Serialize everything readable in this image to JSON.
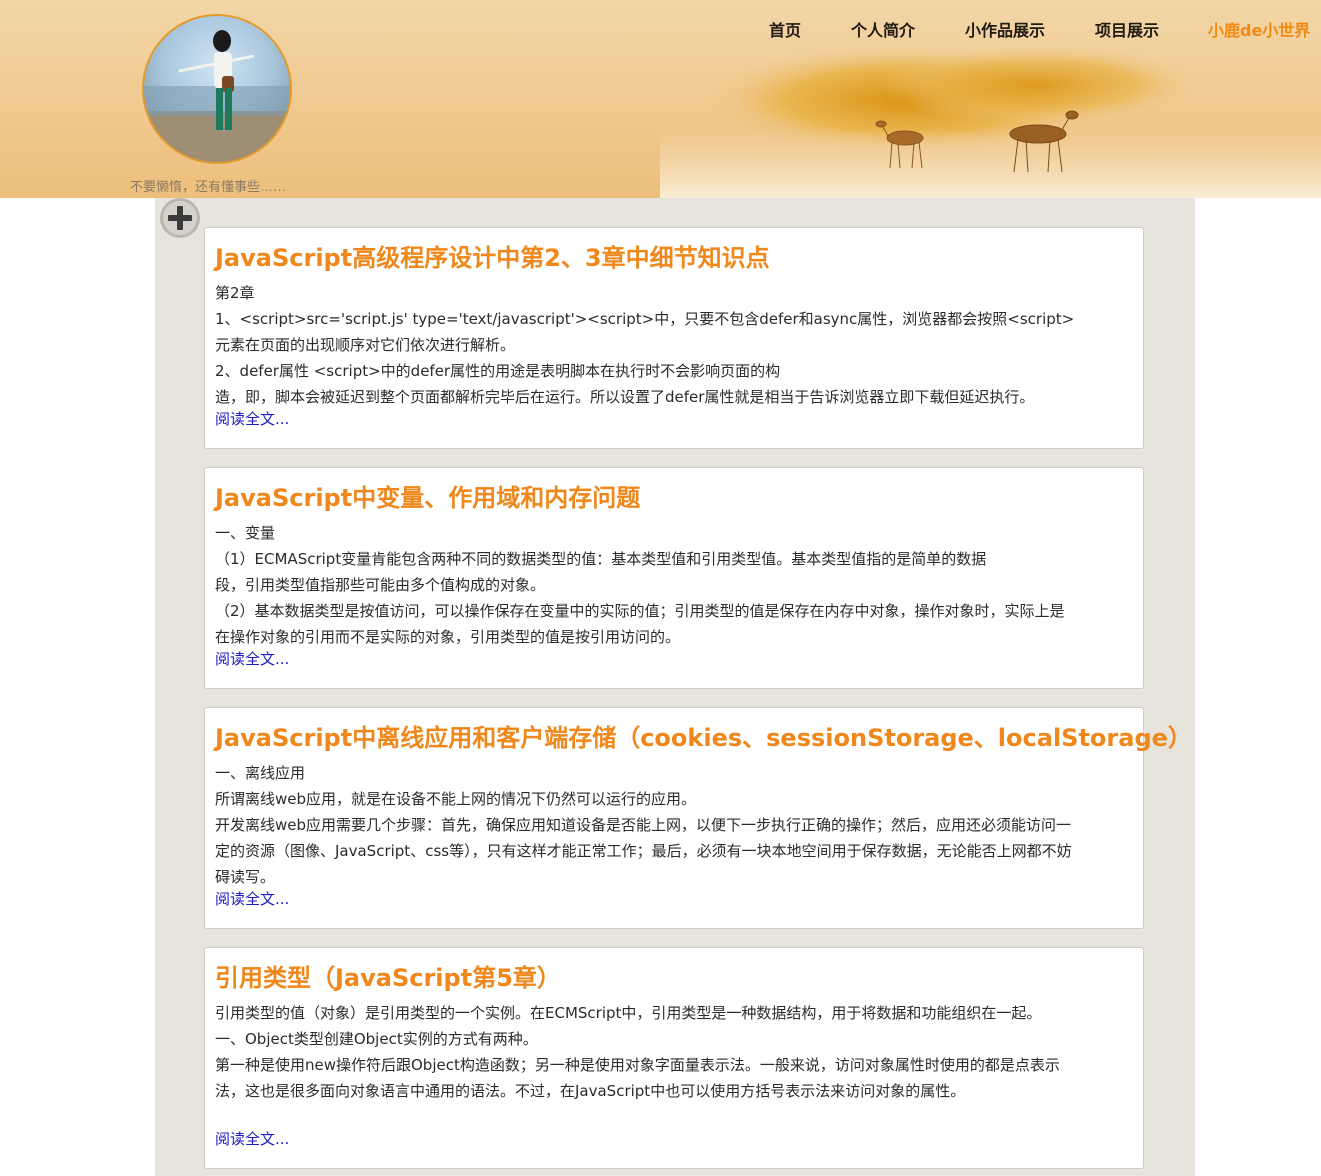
{
  "header": {
    "motto": "不要懒惰，还有懂事些……"
  },
  "nav": {
    "items": [
      {
        "label": "首页"
      },
      {
        "label": "个人简介"
      },
      {
        "label": "小作品展示"
      },
      {
        "label": "项目展示"
      },
      {
        "label": "小鹿de小世界"
      }
    ]
  },
  "articles": [
    {
      "title": "JavaScript高级程序设计中第2、3章中细节知识点",
      "lines": [
        "第2章",
        "1、<script>src='script.js' type='text/javascript'><script>中，只要不包含defer和async属性，浏览器都会按照<script>",
        "元素在页面的出现顺序对它们依次进行解析。",
        "2、defer属性 <script>中的defer属性的用途是表明脚本在执行时不会影响页面的构",
        "造，即，脚本会被延迟到整个页面都解析完毕后在运行。所以设置了defer属性就是相当于告诉浏览器立即下载但延迟执行。"
      ],
      "read_more": "阅读全文..."
    },
    {
      "title": "JavaScript中变量、作用域和内存问题",
      "lines": [
        "一、变量",
        "（1）ECMAScript变量肯能包含两种不同的数据类型的值：基本类型值和引用类型值。基本类型值指的是简单的数据",
        "段，引用类型值指那些可能由多个值构成的对象。",
        "（2）基本数据类型是按值访问，可以操作保存在变量中的实际的值；引用类型的值是保存在内存中对象，操作对象时，实际上是",
        "在操作对象的引用而不是实际的对象，引用类型的值是按引用访问的。"
      ],
      "read_more": "阅读全文..."
    },
    {
      "title": "JavaScript中离线应用和客户端存储（cookies、sessionStorage、localStorage）",
      "lines": [
        "一、离线应用",
        "所谓离线web应用，就是在设备不能上网的情况下仍然可以运行的应用。",
        "开发离线web应用需要几个步骤：首先，确保应用知道设备是否能上网，以便下一步执行正确的操作；然后，应用还必须能访问一",
        "定的资源（图像、JavaScript、css等），只有这样才能正常工作；最后，必须有一块本地空间用于保存数据，无论能否上网都不妨",
        "碍读写。"
      ],
      "read_more": "阅读全文..."
    },
    {
      "title": "引用类型（JavaScript第5章）",
      "lines": [
        "引用类型的值（对象）是引用类型的一个实例。在ECMScript中，引用类型是一种数据结构，用于将数据和功能组织在一起。",
        "一、Object类型创建Object实例的方式有两种。",
        "第一种是使用new操作符后跟Object构造函数；另一种是使用对象字面量表示法。一般来说，访问对象属性时使用的都是点表示",
        "法，这也是很多面向对象语言中通用的语法。不过，在JavaScript中也可以使用方括号表示法来访问对象的属性。"
      ],
      "read_more": "阅读全文..."
    }
  ]
}
